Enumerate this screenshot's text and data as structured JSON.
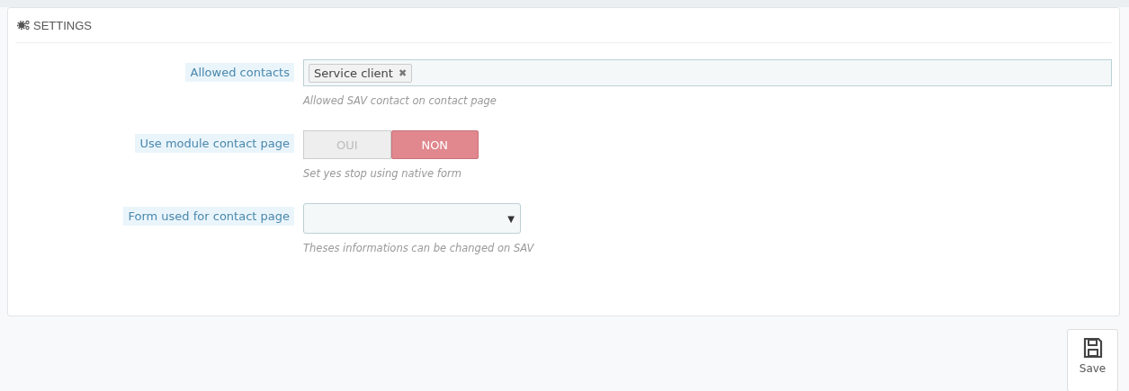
{
  "panel": {
    "title": "SETTINGS"
  },
  "fields": [
    {
      "kind": "tags",
      "label": "Allowed contacts",
      "tags": [
        {
          "text": "Service client",
          "remove": "✖"
        }
      ],
      "help": "Allowed SAV contact on contact page"
    },
    {
      "kind": "switch",
      "label": "Use module contact page",
      "options": [
        {
          "text": "OUI",
          "selected": false
        },
        {
          "text": "NON",
          "selected": true
        }
      ],
      "help": "Set yes stop using native form"
    },
    {
      "kind": "select",
      "label": "Form used for contact page",
      "arrow": "▼",
      "help": "Theses informations can be changed on SAV"
    }
  ],
  "save_button": {
    "label": "Save"
  }
}
